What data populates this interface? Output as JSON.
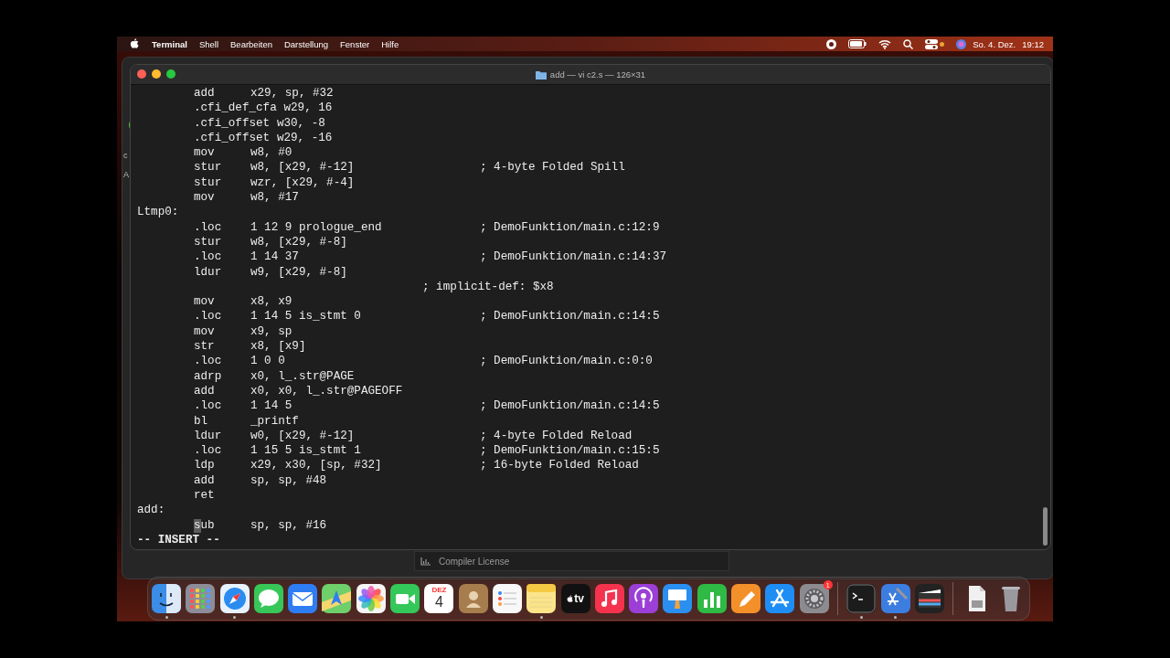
{
  "menu_bar": {
    "app": "Terminal",
    "items": [
      "Shell",
      "Bearbeiten",
      "Darstellung",
      "Fenster",
      "Hilfe"
    ],
    "date": "So. 4. Dez.",
    "time": "19:12"
  },
  "background_window": {
    "letters": [
      "c",
      "A"
    ],
    "panel_label": "Compiler License"
  },
  "terminal": {
    "title": "add — vi c2.s — 126×31",
    "lines": [
      {
        "kind": "instr",
        "op": "add",
        "args": "x29, sp, #32"
      },
      {
        "kind": "instr",
        "op": ".cfi_def_cfa",
        "args": "w29, 16"
      },
      {
        "kind": "instr",
        "op": ".cfi_offset",
        "args": "w30, -8"
      },
      {
        "kind": "instr",
        "op": ".cfi_offset",
        "args": "w29, -16"
      },
      {
        "kind": "instr",
        "op": "mov",
        "args": "w8, #0"
      },
      {
        "kind": "instr",
        "op": "stur",
        "args": "w8, [x29, #-12]",
        "comment": "; 4-byte Folded Spill"
      },
      {
        "kind": "instr",
        "op": "stur",
        "args": "wzr, [x29, #-4]"
      },
      {
        "kind": "instr",
        "op": "mov",
        "args": "w8, #17"
      },
      {
        "kind": "label",
        "text": "Ltmp0:"
      },
      {
        "kind": "instr",
        "op": ".loc",
        "args": "1 12 9 prologue_end",
        "comment": "; DemoFunktion/main.c:12:9"
      },
      {
        "kind": "instr",
        "op": "stur",
        "args": "w8, [x29, #-8]"
      },
      {
        "kind": "instr",
        "op": ".loc",
        "args": "1 14 37",
        "comment": "; DemoFunktion/main.c:14:37"
      },
      {
        "kind": "instr",
        "op": "ldur",
        "args": "w9, [x29, #-8]"
      },
      {
        "kind": "note",
        "text": "; implicit-def: $x8"
      },
      {
        "kind": "instr",
        "op": "mov",
        "args": "x8, x9"
      },
      {
        "kind": "instr",
        "op": ".loc",
        "args": "1 14 5 is_stmt 0",
        "comment": "; DemoFunktion/main.c:14:5"
      },
      {
        "kind": "instr",
        "op": "mov",
        "args": "x9, sp"
      },
      {
        "kind": "instr",
        "op": "str",
        "args": "x8, [x9]"
      },
      {
        "kind": "instr",
        "op": ".loc",
        "args": "1 0 0",
        "comment": "; DemoFunktion/main.c:0:0"
      },
      {
        "kind": "instr",
        "op": "adrp",
        "args": "x0, l_.str@PAGE"
      },
      {
        "kind": "instr",
        "op": "add",
        "args": "x0, x0, l_.str@PAGEOFF"
      },
      {
        "kind": "instr",
        "op": ".loc",
        "args": "1 14 5",
        "comment": "; DemoFunktion/main.c:14:5"
      },
      {
        "kind": "instr",
        "op": "bl",
        "args": "_printf"
      },
      {
        "kind": "instr",
        "op": "ldur",
        "args": "w0, [x29, #-12]",
        "comment": "; 4-byte Folded Reload"
      },
      {
        "kind": "instr",
        "op": ".loc",
        "args": "1 15 5 is_stmt 1",
        "comment": "; DemoFunktion/main.c:15:5"
      },
      {
        "kind": "instr",
        "op": "ldp",
        "args": "x29, x30, [sp, #32]",
        "comment": "; 16-byte Folded Reload"
      },
      {
        "kind": "instr",
        "op": "add",
        "args": "sp, sp, #48"
      },
      {
        "kind": "instr",
        "op": "ret"
      },
      {
        "kind": "label",
        "text": "add:"
      },
      {
        "kind": "instr",
        "op": "sub",
        "args": "sp, sp, #16",
        "cursor": true
      },
      {
        "kind": "mode",
        "text": "-- INSERT --"
      }
    ]
  },
  "dock": [
    {
      "kind": "finder",
      "running": true
    },
    {
      "kind": "launchpad",
      "running": false
    },
    {
      "kind": "safari",
      "running": true
    },
    {
      "kind": "messages",
      "running": false
    },
    {
      "kind": "mail",
      "running": false
    },
    {
      "kind": "maps",
      "running": false
    },
    {
      "kind": "photos",
      "running": false
    },
    {
      "kind": "facetime",
      "running": false
    },
    {
      "kind": "calendar",
      "running": false,
      "month": "DEZ",
      "day": "4"
    },
    {
      "kind": "contacts",
      "running": false
    },
    {
      "kind": "reminders",
      "running": false
    },
    {
      "kind": "notes",
      "running": true
    },
    {
      "kind": "tv",
      "running": false,
      "label": "tv"
    },
    {
      "kind": "music",
      "running": false
    },
    {
      "kind": "podcasts",
      "running": false
    },
    {
      "kind": "keynote",
      "running": false
    },
    {
      "kind": "numbers",
      "running": false
    },
    {
      "kind": "pages",
      "running": false
    },
    {
      "kind": "appstore",
      "running": false
    },
    {
      "kind": "settings",
      "running": false,
      "badge": "1"
    },
    {
      "kind": "divider"
    },
    {
      "kind": "terminal",
      "running": true
    },
    {
      "kind": "xcode",
      "running": true
    },
    {
      "kind": "finalcut",
      "running": false
    },
    {
      "kind": "divider"
    },
    {
      "kind": "document",
      "running": false
    },
    {
      "kind": "trash",
      "running": false
    }
  ]
}
